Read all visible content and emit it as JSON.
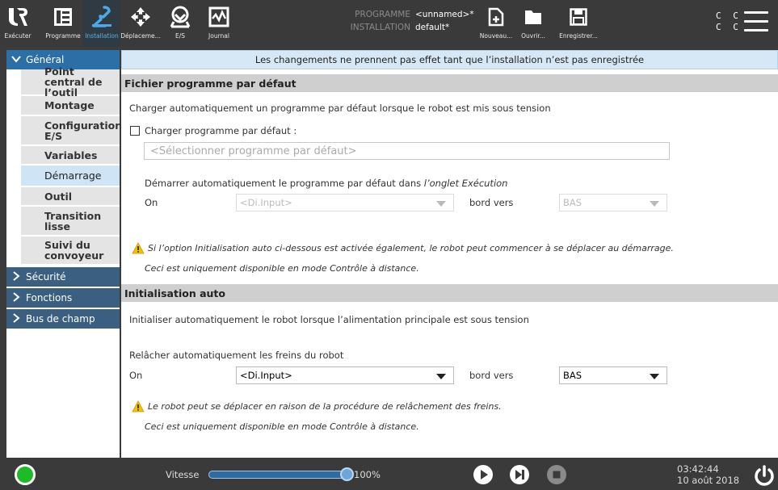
{
  "topbar": {
    "tabs": [
      {
        "label": "Exécuter",
        "icon": "ur-logo-icon"
      },
      {
        "label": "Programme",
        "icon": "program-icon"
      },
      {
        "label": "Installation",
        "icon": "installation-icon"
      },
      {
        "label": "Déplaceme...",
        "icon": "move-icon"
      },
      {
        "label": "E/S",
        "icon": "io-icon"
      },
      {
        "label": "Journal",
        "icon": "log-icon"
      }
    ],
    "program_key": "PROGRAMME",
    "program_value": "<unnamed>*",
    "installation_key": "INSTALLATION",
    "installation_value": "default*",
    "actions": [
      {
        "label": "Nouveau...",
        "icon": "new-file-icon"
      },
      {
        "label": "Ouvrir...",
        "icon": "folder-icon"
      },
      {
        "label": "Enregistrer...",
        "icon": "save-icon"
      }
    ],
    "cc_line1": "C C",
    "cc_line2": "C C"
  },
  "sidebar": {
    "general": "Général",
    "items": [
      "Point central de l’outil",
      "Montage",
      "Configuration E/S",
      "Variables",
      "Démarrage",
      "Outil",
      "Transition lisse",
      "Suivi du convoyeur"
    ],
    "selected_item": "Démarrage",
    "sections": [
      "Sécurité",
      "Fonctions",
      "Bus de champ"
    ]
  },
  "content": {
    "banner": "Les changements ne prennent pas effet tant que l’installation n’est pas enregistrée",
    "default_program": {
      "title": "Fichier programme par défaut",
      "description": "Charger automatiquement un programme par défaut lorsque le robot est mis sous tension",
      "checkbox_label": "Charger programme par défaut :",
      "program_placeholder": "<Sélectionner programme par défaut>",
      "autostart_text": "Démarrer automatiquement le programme par défaut dans ",
      "autostart_italic": "l’onglet Exécution",
      "on_label": "On",
      "input_value": "<Di.Input>",
      "edge_label": "bord vers",
      "edge_value": "BAS",
      "warning_1": "Si l’option Initialisation auto ci-dessous est activée également, le robot peut commencer à se déplacer au démarrage.",
      "warning_2": "Ceci est uniquement disponible en mode Contrôle à distance."
    },
    "auto_init": {
      "title": "Initialisation auto",
      "description": "Initialiser automatiquement le robot lorsque l’alimentation principale est sous tension",
      "brake_text": "Relâcher automatiquement les freins du robot",
      "on_label": "On",
      "input_value": "<Di.Input>",
      "edge_label": "bord vers",
      "edge_value": "BAS",
      "warning_1": "Le robot peut se déplacer en raison de la procédure de relâchement des freins.",
      "warning_2": "Ceci est uniquement disponible en mode Contrôle à distance."
    }
  },
  "bottombar": {
    "speed_label": "Vitesse",
    "speed_value": "100%",
    "speed_fraction": 1.0,
    "time": "03:42:44",
    "date": "10 août 2018"
  },
  "colors": {
    "accent": "#2c6fa6",
    "status_green": "#1dbb25",
    "warning": "#f2c200"
  }
}
